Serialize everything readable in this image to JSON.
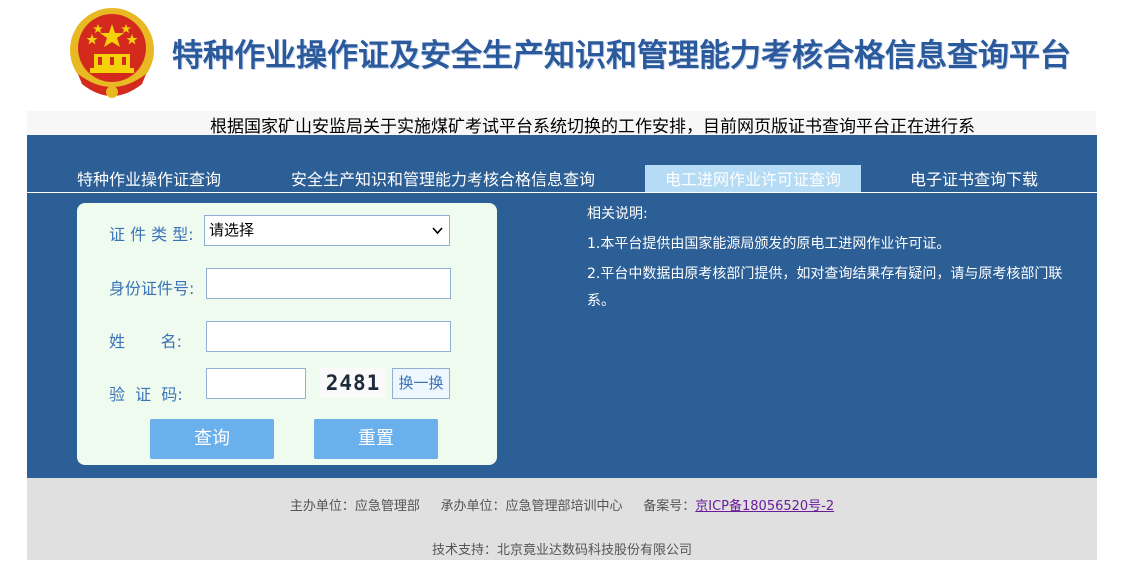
{
  "header": {
    "title": "特种作业操作证及安全生产知识和管理能力考核合格信息查询平台",
    "emblem_icon": "national-emblem-icon"
  },
  "notice": {
    "text": "根据国家矿山安监局关于实施煤矿考试平台系统切换的工作安排，目前网页版证书查询平台正在进行系"
  },
  "tabs": [
    {
      "label": "特种作业操作证查询",
      "active": false
    },
    {
      "label": "安全生产知识和管理能力考核合格信息查询",
      "active": false
    },
    {
      "label": "电工进网作业许可证查询",
      "active": true
    },
    {
      "label": "电子证书查询下载",
      "active": false
    }
  ],
  "form": {
    "cert_type_label": "证 件 类 型:",
    "cert_type_value": "请选择",
    "id_label": "身份证件号:",
    "id_value": "",
    "name_label": "姓       名:",
    "name_value": "",
    "captcha_label": "验  证  码:",
    "captcha_value": "",
    "captcha_image_text": "2481",
    "refresh_label": "换一换",
    "query_label": "查询",
    "reset_label": "重置"
  },
  "notes": {
    "heading": "相关说明:",
    "item1": "1.本平台提供由国家能源局颁发的原电工进网作业许可证。",
    "item2": "2.平台中数据由原考核部门提供，如对查询结果存有疑问，请与原考核部门联系。"
  },
  "footer": {
    "sponsor": "主办单位：应急管理部",
    "organizer": "承办单位：应急管理部培训中心",
    "icp_label": "备案号：",
    "icp_link": "京ICP备18056520号-2",
    "tech_support": "技术支持：北京竟业达数码科技股份有限公司"
  },
  "colors": {
    "main_blue": "#2c5f96",
    "active_tab": "#b6dcf5",
    "card_bg": "#effbee",
    "button_blue": "#6ab0ec",
    "title_blue": "#2b5a9c"
  }
}
